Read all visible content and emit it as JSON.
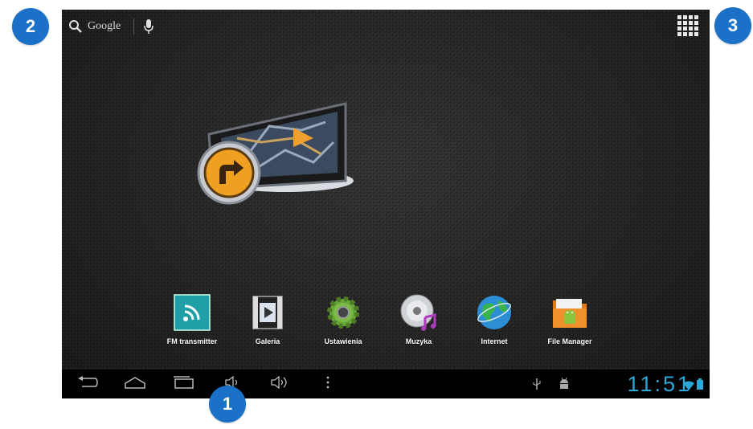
{
  "search": {
    "brand": "Google"
  },
  "dock": {
    "items": [
      {
        "label": "FM transmitter",
        "icon": "fm-transmitter-icon"
      },
      {
        "label": "Galeria",
        "icon": "gallery-icon"
      },
      {
        "label": "Ustawienia",
        "icon": "settings-icon"
      },
      {
        "label": "Muzyka",
        "icon": "music-icon"
      },
      {
        "label": "Internet",
        "icon": "internet-icon"
      },
      {
        "label": "File Manager",
        "icon": "file-manager-icon"
      }
    ]
  },
  "statusbar": {
    "time": "11:51"
  },
  "callouts": {
    "first": "1",
    "second": "2",
    "third": "3"
  },
  "colors": {
    "callout": "#1b71c8",
    "clock": "#2aa8d8",
    "fm_icon": "#1fa0a6"
  }
}
